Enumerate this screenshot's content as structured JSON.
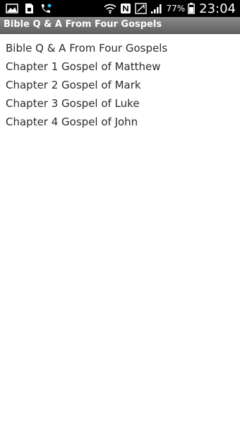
{
  "status_bar": {
    "battery": "77%",
    "time": "23:04",
    "icons": [
      "gallery-icon",
      "sim-toolkit-icon",
      "phone-icon",
      "wifi-icon",
      "nfc-icon",
      "data-icon",
      "signal-icon",
      "battery-icon"
    ]
  },
  "app_bar": {
    "title": "Bible Q & A From Four Gospels"
  },
  "menu": {
    "items": [
      "Bible Q & A From Four Gospels",
      "Chapter 1 Gospel of Matthew",
      "Chapter 2 Gospel of Mark",
      "Chapter 3 Gospel of Luke",
      "Chapter 4 Gospel of John"
    ]
  },
  "colors": {
    "status_bar_bg": "#000000",
    "title_bar_bg": "#707070",
    "list_text": "#2b2b2b",
    "page_bg": "#ffffff"
  }
}
